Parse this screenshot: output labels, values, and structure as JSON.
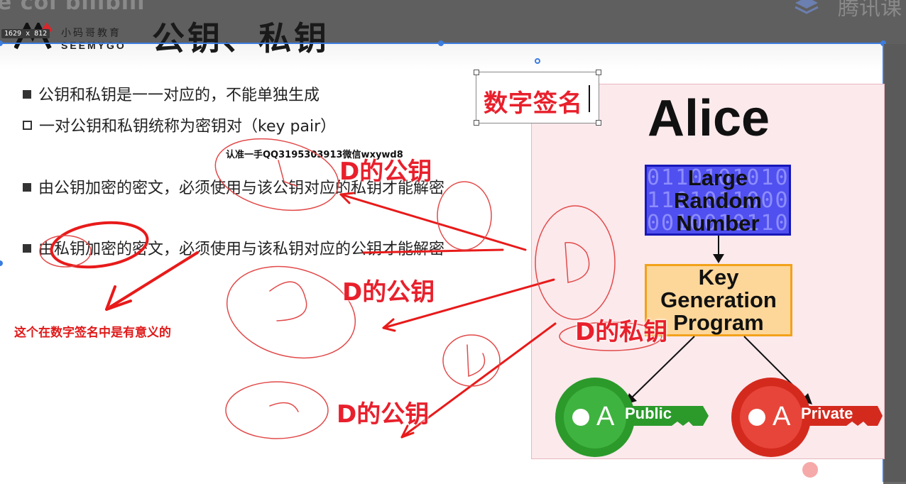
{
  "window": {
    "ghost_left_text": "e col bilibili",
    "ghost_right_text": "腾讯课",
    "dimension_badge": "1629 x 812"
  },
  "logo": {
    "cn": "小码哥教育",
    "en": "SEEMYGO"
  },
  "slide": {
    "title": "公钥、私钥",
    "bullets": [
      {
        "text": "公钥和私钥是一一对应的，不能单独生成",
        "marker": "filled"
      },
      {
        "text": "一对公钥和私钥统称为密钥对（key pair）",
        "marker": "hollow"
      },
      {
        "text": "由公钥加密的密文，必须使用与该公钥对应的私钥才能解密",
        "marker": "filled"
      },
      {
        "text": "由私钥加密的密文，必须使用与该私钥对应的公钥才能解密",
        "marker": "filled"
      }
    ],
    "watermark": "认准一手QQ3195303913微信wxywd8",
    "note": "这个在数字签名中是有意义的"
  },
  "text_box": {
    "text": "数字签名"
  },
  "annotations": {
    "pub_top": "D的公钥",
    "pub_mid": "D的公钥",
    "pub_bottom": "D的公钥",
    "private": "D的私钥"
  },
  "diagram": {
    "name": "Alice",
    "large_box": {
      "label_lines": [
        "Large",
        "Random",
        "Number"
      ],
      "bits": "0110101010\n1101011000\n0010010110"
    },
    "key_box": {
      "label_lines": [
        "Key",
        "Generation",
        "Program"
      ]
    },
    "public_key": {
      "letter": "A",
      "label": "Public"
    },
    "private_key": {
      "letter": "A",
      "label": "Private"
    }
  },
  "colors": {
    "accent_red": "#e8202c",
    "selection_blue": "#3b7de0",
    "random_box": "#5050f0",
    "key_box": "#fdd79a",
    "public_green": "#2b9a2b",
    "private_red": "#d42a1e",
    "panel_pink": "#fce9ec"
  }
}
